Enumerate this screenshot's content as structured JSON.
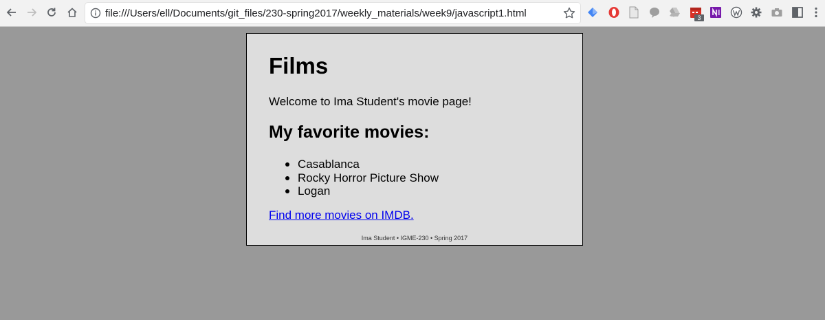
{
  "browser": {
    "url": "file:///Users/ell/Documents/git_files/230-spring2017/weekly_materials/week9/javascript1.html",
    "extensions": [
      {
        "name": "bookmark-extension-icon",
        "color": "#4285f4"
      },
      {
        "name": "opera-vpn-icon",
        "color": "#e53935"
      },
      {
        "name": "document-icon",
        "color": "#9e9e9e"
      },
      {
        "name": "speech-bubble-icon",
        "color": "#9e9e9e"
      },
      {
        "name": "drive-icon",
        "color": "#9e9e9e"
      },
      {
        "name": "calendar-icon",
        "color": "#d93025"
      },
      {
        "name": "onenote-icon",
        "color": "#7719aa"
      },
      {
        "name": "wordpress-icon",
        "color": "#5f6368"
      },
      {
        "name": "gear-icon",
        "color": "#5f6368"
      },
      {
        "name": "camera-icon",
        "color": "#9e9e9e"
      },
      {
        "name": "window-icon",
        "color": "#5f6368"
      },
      {
        "name": "menu-icon",
        "color": "#5f6368"
      }
    ],
    "calendar_badge": "3"
  },
  "page": {
    "title": "Films",
    "welcome": "Welcome to Ima Student's movie page!",
    "favorites_heading": "My favorite movies:",
    "movies": [
      "Casablanca",
      "Rocky Horror Picture Show",
      "Logan"
    ],
    "link_text": "Find more movies on IMDB.",
    "footer": "Ima Student • IGME-230 • Spring 2017"
  },
  "colors": {
    "page_background": "#999999",
    "card_background": "#dddddd",
    "link": "#0000ee"
  }
}
